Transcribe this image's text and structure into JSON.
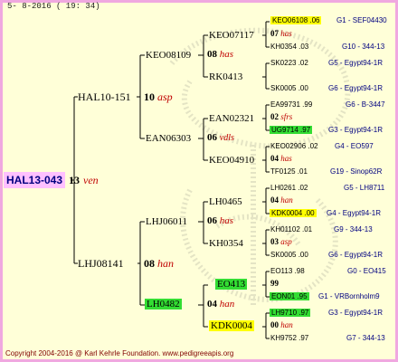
{
  "header": {
    "date": "5- 8-2016 ( 19: 34)"
  },
  "footer": {
    "copyright": "Copyright 2004-2016 @ Karl Kehrle Foundation.   www.pedigreeapis.org"
  },
  "root": {
    "id": "HAL13-043",
    "year": "13",
    "name": "ven"
  },
  "gen2": {
    "sire": {
      "id": "HAL10-151",
      "year": "10",
      "name": "asp"
    },
    "dam": {
      "id": "LHJ08141",
      "year": "08",
      "name": "han"
    }
  },
  "gen3": {
    "a": {
      "id": "KEO08109",
      "year": "08",
      "name": "has"
    },
    "b": {
      "id": "EAN06303",
      "year": "06",
      "name": "vdls"
    },
    "c": {
      "id": "LHJ06011",
      "year": "06",
      "name": "has"
    },
    "d": {
      "id": "LH0482",
      "year": "04",
      "name": "han"
    }
  },
  "gen4": {
    "a1": {
      "id": "KEO07117",
      "year": "07",
      "name": "has"
    },
    "a2": {
      "id": "RK0413"
    },
    "b1": {
      "id": "EAN02321",
      "year": "02",
      "name": "sfrs"
    },
    "b2": {
      "id": "KEO04910",
      "year": "04",
      "name": "has"
    },
    "c1": {
      "id": "LH0465",
      "year": "04",
      "name": "han"
    },
    "c2": {
      "id": "KH0354",
      "year": "03",
      "name": "asp"
    },
    "d1": {
      "id": "EO413",
      "year": "99",
      "name": ""
    },
    "d2": {
      "id": "KDK0004",
      "year": "00",
      "name": "han"
    }
  },
  "gen5": [
    {
      "id": "KEO06108 .06",
      "loc": "G1 - SEF04430"
    },
    {
      "id": "KH0354 .03",
      "loc": "G10 - 344-13"
    },
    {
      "id": "SK0223 .02",
      "loc": "G5 - Egypt94-1R"
    },
    {
      "id": "SK0005 .00",
      "loc": "G6 - Egypt94-1R"
    },
    {
      "id": "EA99731 .99",
      "loc": "G6 - B-3447"
    },
    {
      "id": "UG9714 .97",
      "loc": "G3 - Egypt94-1R"
    },
    {
      "id": "KEO02906 .02",
      "loc": "G4 - EO597"
    },
    {
      "id": "TF0125 .01",
      "loc": "G19 - Sinop62R"
    },
    {
      "id": "LH0261 .02",
      "loc": "G5 - LH8711"
    },
    {
      "id": "KDK0004 .00",
      "loc": "G4 - Egypt94-1R"
    },
    {
      "id": "KH01102 .01",
      "loc": "G9 - 344-13"
    },
    {
      "id": "SK0005 .00",
      "loc": "G6 - Egypt94-1R"
    },
    {
      "id": "EO113 .98",
      "loc": "G0 - EO415"
    },
    {
      "id": "EON01 .95",
      "loc": "G1 - VRBornholm9"
    },
    {
      "id": "LH9710 .97",
      "loc": "G3 - Egypt94-1R"
    },
    {
      "id": "KH9752 .97",
      "loc": "G7 - 344-13"
    }
  ]
}
